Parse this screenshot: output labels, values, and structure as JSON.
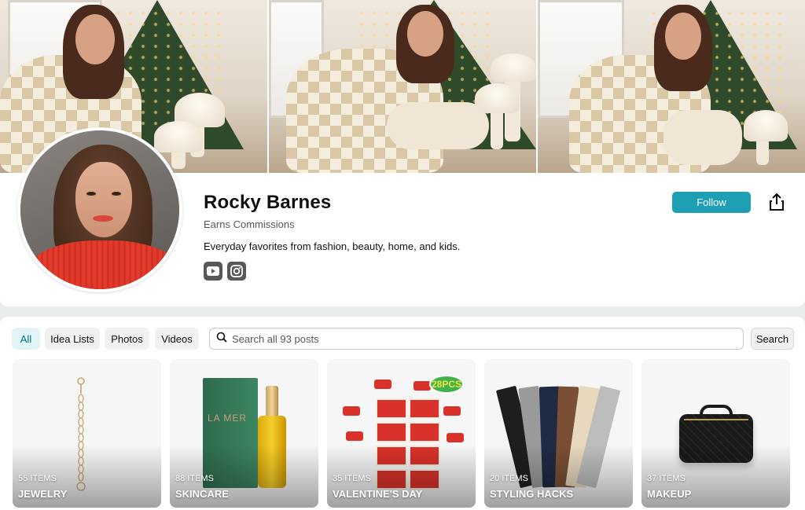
{
  "profile": {
    "name": "Rocky Barnes",
    "earns": "Earns Commissions",
    "bio": "Everyday favorites from fashion, beauty, home, and kids.",
    "follow_label": "Follow",
    "socials": [
      "youtube-icon",
      "instagram-icon"
    ]
  },
  "filters": {
    "tabs": [
      {
        "label": "All",
        "active": true
      },
      {
        "label": "Idea Lists",
        "active": false
      },
      {
        "label": "Photos",
        "active": false
      },
      {
        "label": "Videos",
        "active": false
      }
    ]
  },
  "search": {
    "placeholder": "Search all 93 posts",
    "button_label": "Search"
  },
  "lists": [
    {
      "count": "55 ITEMS",
      "title": "JEWELRY"
    },
    {
      "count": "88 ITEMS",
      "title": "SKINCARE"
    },
    {
      "count": "35 ITEMS",
      "title": "VALENTINE'S DAY"
    },
    {
      "count": "20 ITEMS",
      "title": "STYLING HACKS"
    },
    {
      "count": "37 ITEMS",
      "title": "MAKEUP"
    }
  ],
  "product_art": {
    "skincare_label": "LA MER",
    "toy_badge": "28PCS"
  },
  "colors": {
    "accent": "#1f9fb3",
    "active_tab_bg": "#e3f4f6",
    "active_tab_text": "#007185"
  }
}
